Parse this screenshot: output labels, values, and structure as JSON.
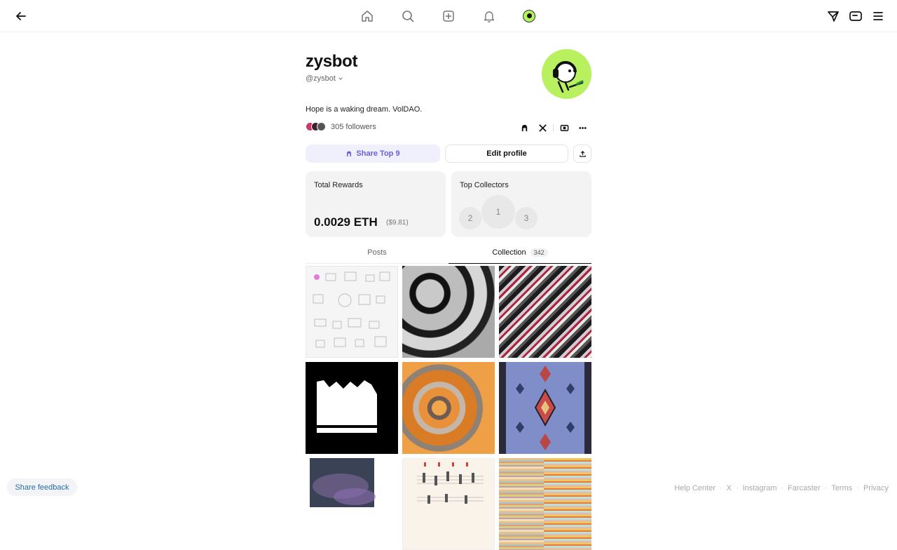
{
  "nav": {
    "icons": [
      "back-arrow-icon",
      "home-icon",
      "search-icon",
      "create-icon",
      "bell-icon",
      "avatar",
      "send-icon",
      "wallet-icon",
      "menu-icon"
    ]
  },
  "profile": {
    "name": "zysbot",
    "handle": "@zysbot",
    "bio": "Hope is a waking dream. VolDAO.",
    "followers": "305 followers"
  },
  "actions": {
    "share_label": "Share Top 9",
    "edit_label": "Edit profile"
  },
  "cards": {
    "rewards_title": "Total Rewards",
    "rewards_eth": "0.0029 ETH",
    "rewards_usd": "($9.81)",
    "collectors_title": "Top Collectors",
    "ranks": [
      "1",
      "2",
      "3"
    ]
  },
  "tabs": {
    "posts": "Posts",
    "collection": "Collection",
    "collection_count": "342"
  },
  "footer": {
    "feedback": "Share feedback",
    "links": [
      "Help Center",
      "X",
      "Instagram",
      "Farcaster",
      "Terms",
      "Privacy"
    ]
  },
  "colors": {
    "accent": "#6b5fd6",
    "avatar_green": "#b8f060"
  }
}
